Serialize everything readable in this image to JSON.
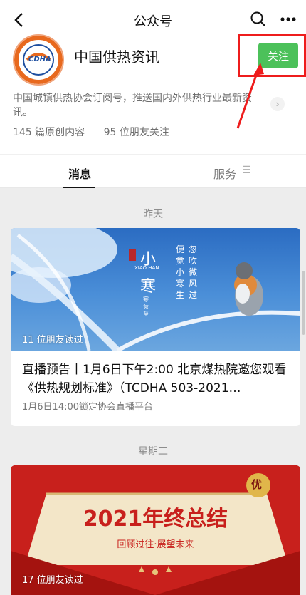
{
  "topbar": {
    "title": "公众号",
    "back_icon": "chevron-left-icon",
    "search_icon": "search-icon",
    "more_icon": "more-dots-icon"
  },
  "account": {
    "name": "中国供热资讯",
    "logo_text": "CDHA",
    "follow_label": "关注",
    "description": "中国城镇供热协会订阅号，推送国内外供热行业最新资讯。",
    "originals": "145 篇原创内容",
    "friends_following": "95 位朋友关注"
  },
  "tabs": {
    "messages": "消息",
    "services": "服务"
  },
  "feed": [
    {
      "date": "昨天",
      "reads": "11 位朋友读过",
      "title": "直播预告丨1月6日下午2:00 北京煤热院邀您观看《供热规划标准》（TCDHA 503-2021…",
      "meta": "1月6日14:00锁定协会直播平台",
      "cover": {
        "seal": "小寒",
        "main": "小",
        "main2": "寒",
        "pinyin": "XIAO HAN",
        "poem1": "忽吹微风过",
        "poem2": "便觉小寒生",
        "seal_small": "寒意至"
      }
    },
    {
      "date": "星期二",
      "reads": "17 位朋友读过",
      "cover": {
        "headline": "2021年终总结",
        "sub": "回顾过往·展望未来",
        "badge": "优"
      }
    }
  ],
  "colors": {
    "follow": "#4cc15a",
    "highlight": "#ee1c1c",
    "cover1": "#2b6cc2",
    "cover2": "#c8201c"
  }
}
